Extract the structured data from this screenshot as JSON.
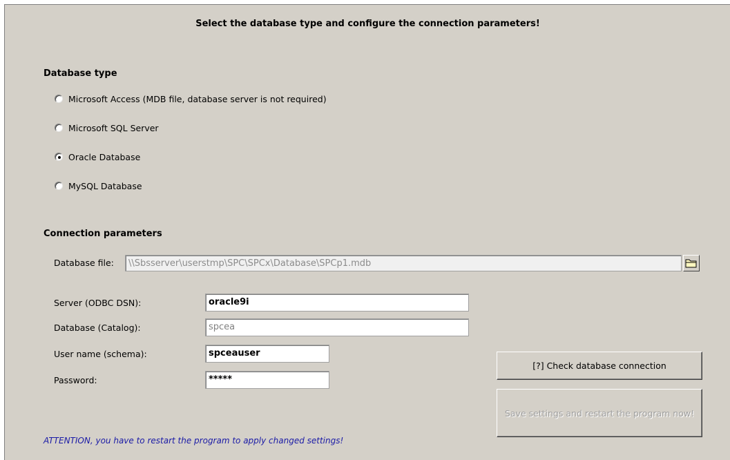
{
  "title": "Select the database type and configure the connection parameters!",
  "database_type": {
    "heading": "Database type",
    "options": [
      {
        "label": "Microsoft Access (MDB file, database server is not required)",
        "selected": false
      },
      {
        "label": "Microsoft SQL Server",
        "selected": false
      },
      {
        "label": "Oracle Database",
        "selected": true
      },
      {
        "label": "MySQL Database",
        "selected": false
      }
    ]
  },
  "connection": {
    "heading": "Connection parameters",
    "database_file_label": "Database file:",
    "database_file_value": "\\\\Sbsserver\\userstmp\\SPC\\SPCx\\Database\\SPCp1.mdb",
    "server_label": "Server (ODBC DSN):",
    "server_value": "oracle9i",
    "catalog_label": "Database (Catalog):",
    "catalog_value": "spcea",
    "username_label": "User name (schema):",
    "username_value": "spceauser",
    "password_label": "Password:",
    "password_value": "*****"
  },
  "buttons": {
    "check_connection": "[?]   Check database connection",
    "save_restart": "Save settings and restart the program now!"
  },
  "attention": "ATTENTION, you have to restart the program to apply changed settings!",
  "icons": {
    "browse": "folder-icon"
  },
  "colors": {
    "panel_bg": "#d4d0c8",
    "attention_text": "#1a1aa6"
  }
}
